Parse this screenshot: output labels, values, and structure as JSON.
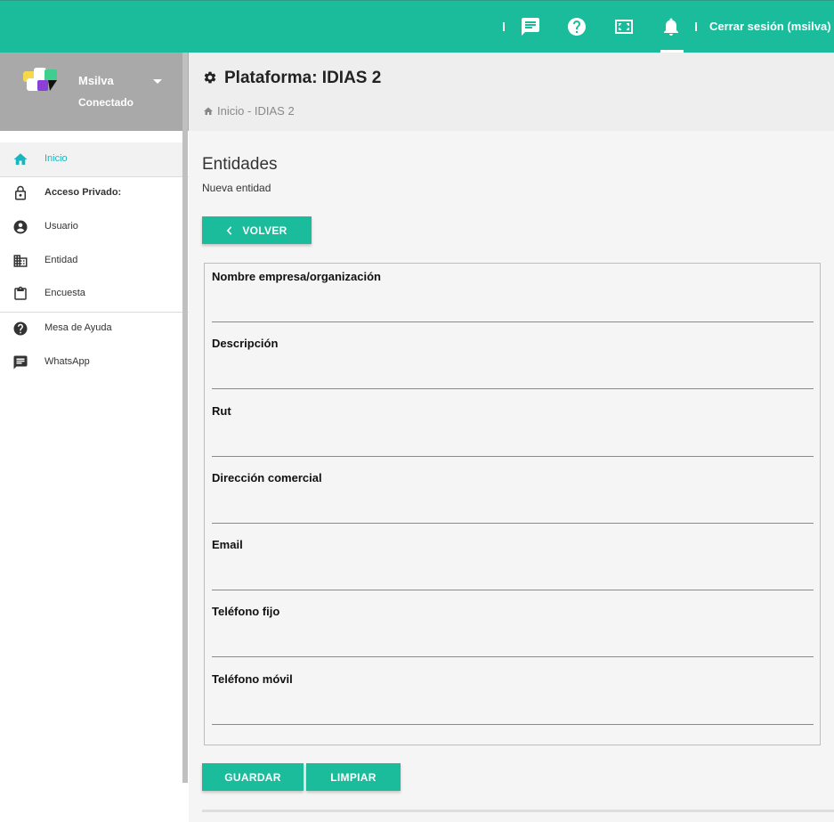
{
  "topbar": {
    "bg_color": "#1abc9c",
    "icons": [
      "chat-icon",
      "help-icon",
      "fullscreen-icon",
      "bell-icon"
    ],
    "logout_label": "Cerrar sesión (msilva)"
  },
  "profile": {
    "name": "Msilva",
    "status": "Conectado"
  },
  "sidebar": {
    "items": [
      {
        "label": "Inicio",
        "icon": "home-icon",
        "active": true
      },
      {
        "label": "Acceso Privado:",
        "icon": "lock-icon",
        "header": true
      },
      {
        "label": "Usuario",
        "icon": "user-icon"
      },
      {
        "label": "Entidad",
        "icon": "building-icon"
      },
      {
        "label": "Encuesta",
        "icon": "clipboard-icon"
      },
      {
        "label": "Mesa de Ayuda",
        "icon": "help-icon"
      },
      {
        "label": "WhatsApp",
        "icon": "chat-icon"
      }
    ]
  },
  "header": {
    "title": "Plataforma: IDIAS 2",
    "breadcrumb": "Inicio - IDIAS 2"
  },
  "main": {
    "section_title": "Entidades",
    "section_subtitle": "Nueva entidad",
    "back_label": "VOLVER",
    "fields": [
      {
        "label": "Nombre empresa/organización",
        "value": ""
      },
      {
        "label": "Descripción",
        "value": ""
      },
      {
        "label": "Rut",
        "value": ""
      },
      {
        "label": "Dirección comercial",
        "value": ""
      },
      {
        "label": "Email",
        "value": ""
      },
      {
        "label": "Teléfono fijo",
        "value": ""
      },
      {
        "label": "Teléfono móvil",
        "value": ""
      }
    ],
    "save_label": "GUARDAR",
    "clear_label": "LIMPIAR"
  }
}
